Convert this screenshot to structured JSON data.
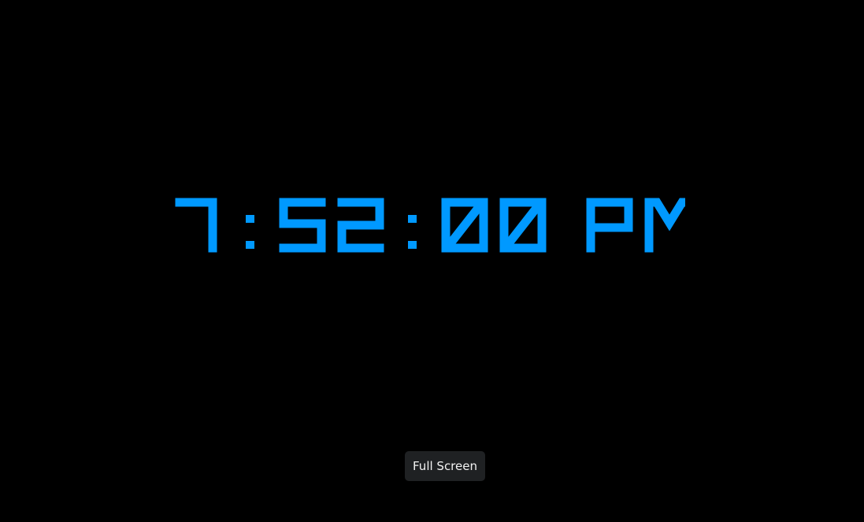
{
  "clock": {
    "hours": "7",
    "minutes": "52",
    "seconds": "00",
    "separator": ":",
    "period": "PM",
    "color": "#0099ff"
  },
  "background_color": "#000000",
  "fullscreen_button": {
    "label": "Full Screen",
    "background": "#1f2123",
    "text_color": "#f2f2f2"
  }
}
